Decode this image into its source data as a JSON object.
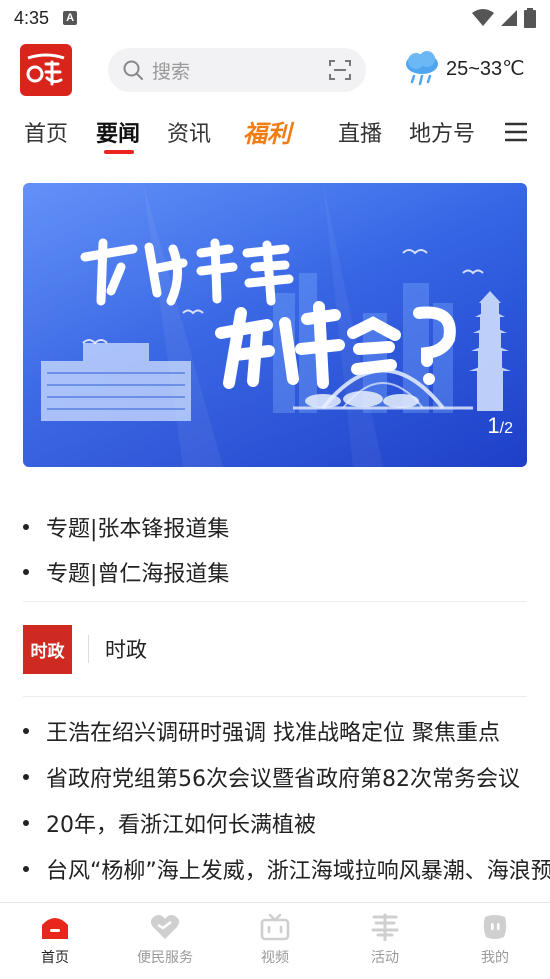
{
  "status_bar": {
    "time": "4:35",
    "app_icon_letter": "A"
  },
  "header": {
    "search_placeholder": "搜索",
    "weather_temp": "25~33℃"
  },
  "tabs": [
    {
      "label": "首页"
    },
    {
      "label": "要闻",
      "active": true
    },
    {
      "label": "资讯"
    },
    {
      "label": "福利"
    },
    {
      "label": "直播"
    },
    {
      "label": "地方号"
    }
  ],
  "banner": {
    "current": "1",
    "separator": "/",
    "total": "2"
  },
  "topics": [
    "专题|张本锋报道集",
    "专题|曾仁海报道集"
  ],
  "section": {
    "badge": "时政",
    "title": "时政"
  },
  "news": [
    "王浩在绍兴调研时强调 找准战略定位 聚焦重点",
    "省政府党组第56次会议暨省政府第82次常务会议",
    "20年，看浙江如何长满植被",
    "台风“杨柳”海上发威，浙江海域拉响风暴潮、海浪预警"
  ],
  "bottom_nav": [
    {
      "label": "首页",
      "icon": "home-icon",
      "active": true
    },
    {
      "label": "便民服务",
      "icon": "heart-icon"
    },
    {
      "label": "视频",
      "icon": "tv-icon"
    },
    {
      "label": "活动",
      "icon": "activity-icon"
    },
    {
      "label": "我的",
      "icon": "profile-icon"
    }
  ],
  "colors": {
    "accent": "#e8261c",
    "brand": "#d9241c",
    "fuli": "#f07c12",
    "banner": "#1a4fe0"
  }
}
